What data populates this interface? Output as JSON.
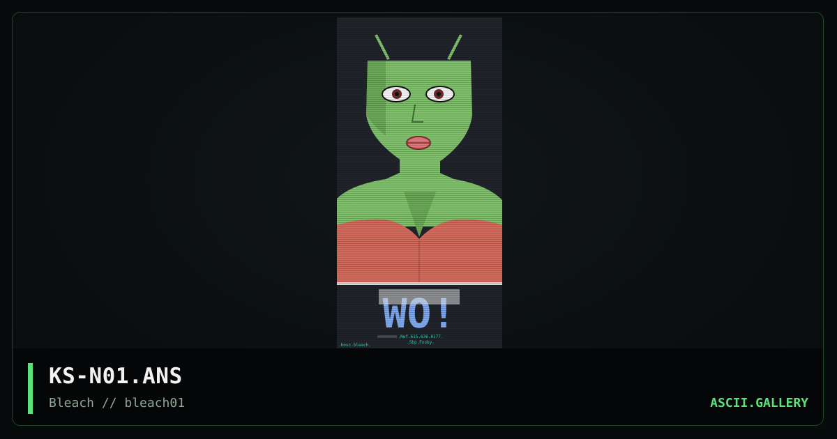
{
  "card": {
    "title": "KS-N01.ANS",
    "subtitle": "Bleach // bleach01",
    "brand": "ASCII.GALLERY"
  },
  "artwork": {
    "description_icon": "ansi-art-alien-portrait",
    "colors": {
      "background": "#20232a",
      "skin": "#7fc06a",
      "skin_shade": "#5f9a4d",
      "top": "#d46a5c",
      "lips": "#e07a7a",
      "logo": "#7fa8ef",
      "footer_text": "#3fd4b8"
    },
    "logo_text": "WO!",
    "credit_lines": [
      ".Nwf.615.636.0177.",
      ".Sbp.Fooby."
    ],
    "signature": ".bosz.bleach."
  },
  "colors": {
    "accent": "#5ee07a",
    "border": "#1f4a27",
    "title": "#f2f2f2",
    "subtitle": "#8fa896"
  }
}
